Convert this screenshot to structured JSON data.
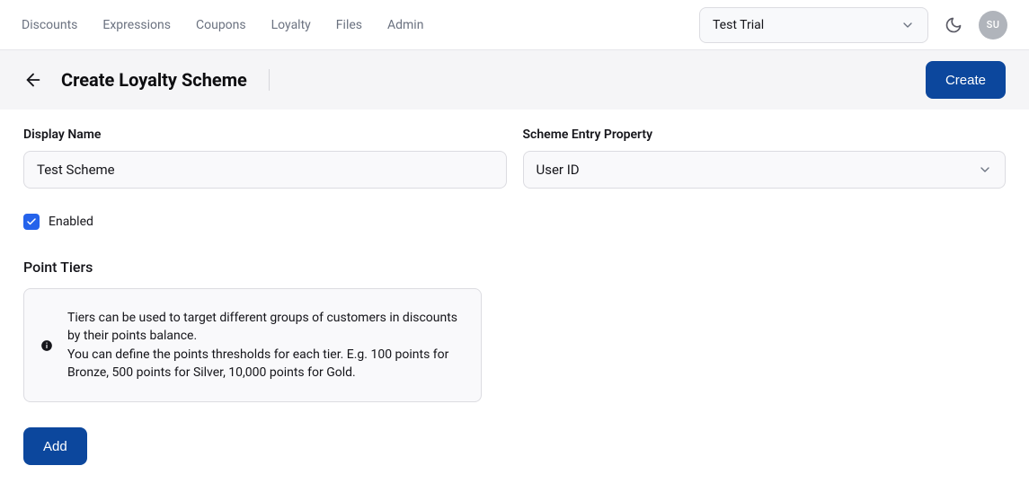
{
  "nav": {
    "items": [
      "Discounts",
      "Expressions",
      "Coupons",
      "Loyalty",
      "Files",
      "Admin"
    ]
  },
  "header": {
    "org_selected": "Test Trial",
    "avatar_initials": "SU",
    "title": "Create Loyalty Scheme",
    "create_button": "Create"
  },
  "form": {
    "display_name_label": "Display Name",
    "display_name_value": "Test Scheme",
    "scheme_entry_label": "Scheme Entry Property",
    "scheme_entry_value": "User ID",
    "enabled_label": "Enabled",
    "enabled_checked": true
  },
  "tiers": {
    "heading": "Point Tiers",
    "info_line1": "Tiers can be used to target different groups of customers in discounts by their points balance.",
    "info_line2": "You can define the points thresholds for each tier. E.g. 100 points for Bronze, 500 points for Silver, 10,000 points for Gold.",
    "add_button": "Add"
  }
}
